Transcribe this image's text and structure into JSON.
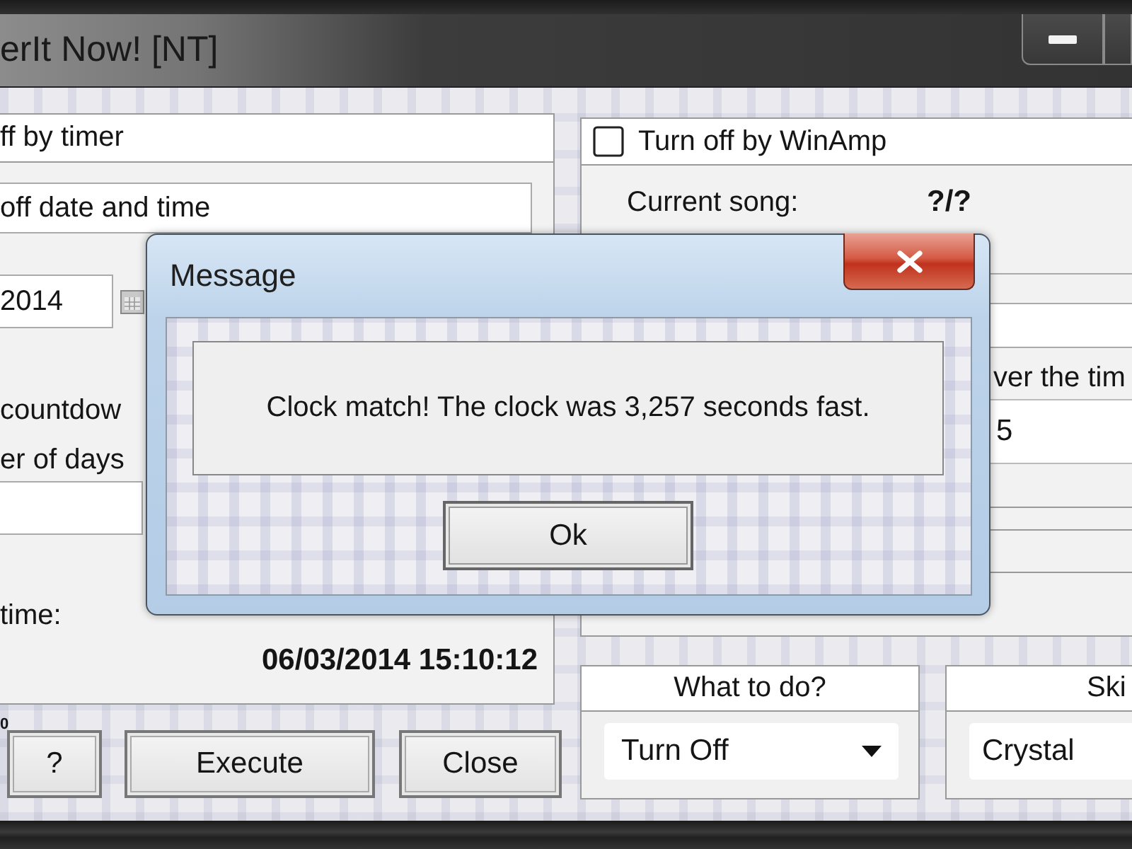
{
  "window": {
    "title": "erIt Now! [NT]"
  },
  "timer_panel": {
    "header": "ff by timer",
    "mode_option": "off date and time",
    "date_field": {
      "value": "2014"
    },
    "countdown_option": "countdow",
    "days_label": "er of days",
    "time_label": "time:",
    "target_time": "06/03/2014 15:10:12"
  },
  "corner_text": "0",
  "buttons": [
    {
      "label": "?"
    },
    {
      "label": "Execute"
    },
    {
      "label": "Close"
    }
  ],
  "winamp_panel": {
    "checkbox": {
      "label": "Turn off by WinAmp",
      "checked": false
    },
    "song_label": "Current song:",
    "song_value": "?/?",
    "option_label": "ver the tim",
    "field_value": "5"
  },
  "action_group": {
    "title": "What to do?",
    "dropdown": {
      "value": "Turn Off"
    }
  },
  "skin_group": {
    "title": "Ski",
    "dropdown": {
      "value": "Crystal"
    }
  },
  "dialog": {
    "title": "Message",
    "message": "Clock match! The clock was 3,257 seconds fast.",
    "button": "Ok"
  }
}
